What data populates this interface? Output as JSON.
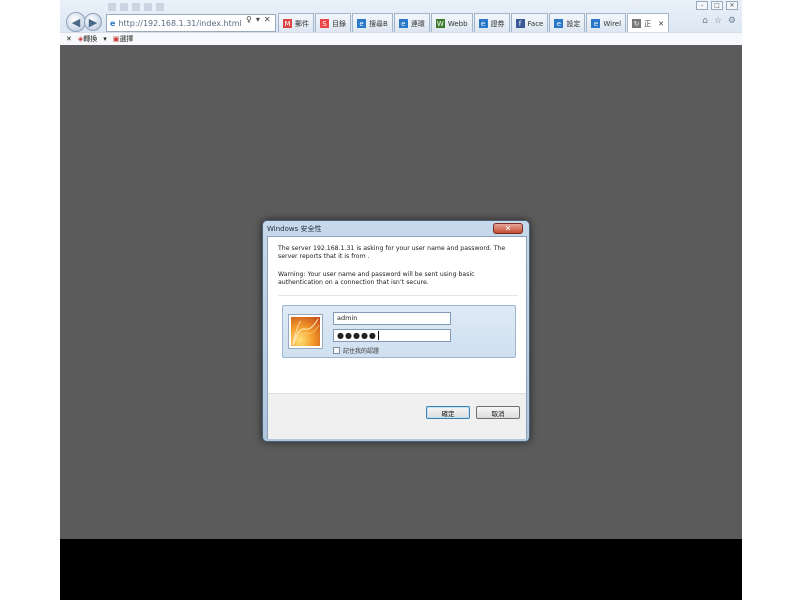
{
  "browser": {
    "address_url": "http://192.168.1.31/index.html",
    "address_tools": [
      "♀",
      "▾",
      "✕"
    ],
    "tabs": [
      {
        "label": "郵件",
        "icon": "M",
        "color": "#d44"
      },
      {
        "label": "目錄",
        "icon": "S",
        "color": "#e44"
      },
      {
        "label": "搜尋B",
        "icon": "e",
        "color": "#2a78c8"
      },
      {
        "label": "連環",
        "icon": "e",
        "color": "#2a78c8"
      },
      {
        "label": "Webb",
        "icon": "W",
        "color": "#3b7a2a"
      },
      {
        "label": "證券",
        "icon": "e",
        "color": "#2a78c8"
      },
      {
        "label": "Face",
        "icon": "f",
        "color": "#3b5998"
      },
      {
        "label": "設定",
        "icon": "e",
        "color": "#2a78c8"
      },
      {
        "label": "Wirel",
        "icon": "e",
        "color": "#2a78c8"
      },
      {
        "label": "正",
        "icon": "↻",
        "color": "#777",
        "active": true
      }
    ],
    "tab_close": "✕",
    "command_bar": {
      "close": "✕",
      "convert": "轉換",
      "dropdown": "▾",
      "select": "選擇"
    },
    "window_controls": [
      "–",
      "□",
      "✕"
    ],
    "side_icons": [
      "⌂",
      "☆",
      "⚙"
    ]
  },
  "dialog": {
    "title": "Windows 安全性",
    "close_label": "✕",
    "message1": "The server 192.168.1.31 is asking for your user name and password. The server reports that it is from .",
    "message2": "Warning: Your user name and password will be sent using basic authentication on a connection that isn’t secure.",
    "username_value": "admin",
    "password_value": "●●●●●",
    "remember_label": "記住我的認證",
    "ok_label": "確定",
    "cancel_label": "取消"
  }
}
